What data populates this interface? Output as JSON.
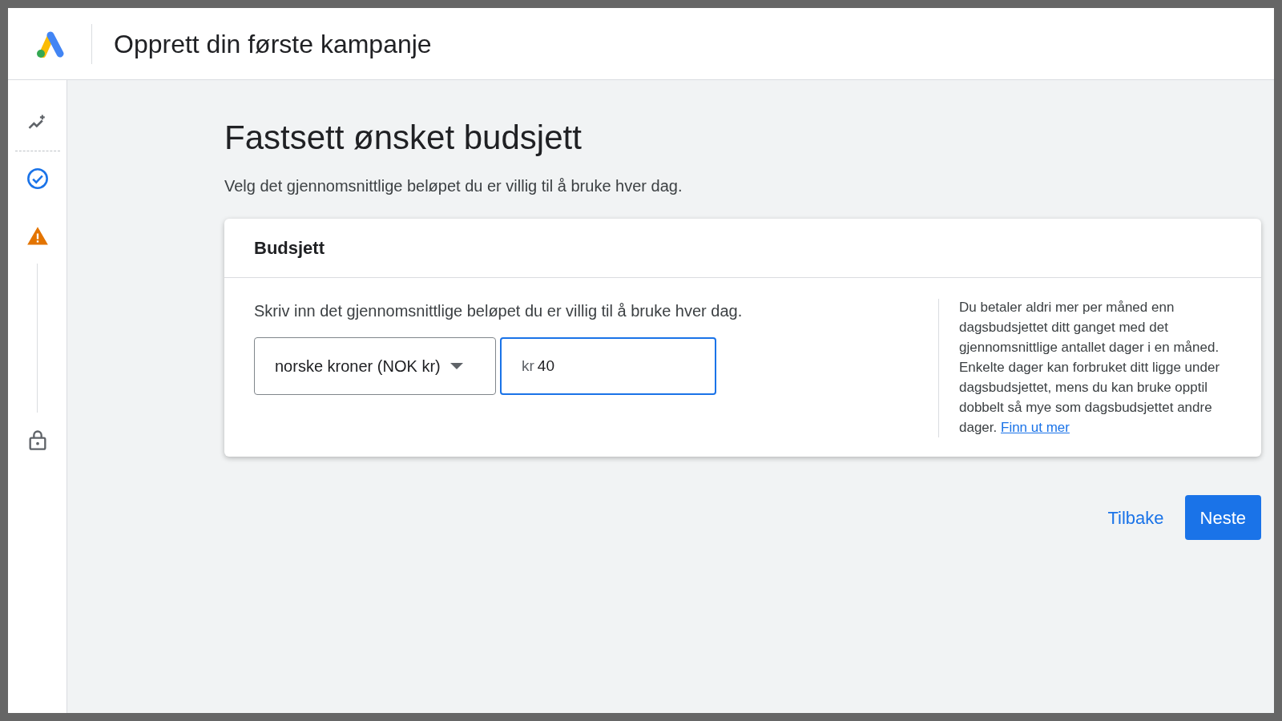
{
  "header": {
    "title": "Opprett din første kampanje"
  },
  "sidebar": {
    "steps": [
      {
        "kind": "sparkle"
      },
      {
        "kind": "done"
      },
      {
        "kind": "warning"
      },
      {
        "kind": "locked"
      }
    ]
  },
  "page": {
    "title": "Fastsett ønsket budsjett",
    "subtitle": "Velg det gjennomsnittlige beløpet du er villig til å bruke hver dag."
  },
  "card": {
    "title": "Budsjett",
    "prompt": "Skriv inn det gjennomsnittlige beløpet du er villig til å bruke hver dag.",
    "currency": {
      "value": "norske kroner (NOK kr)"
    },
    "amount": {
      "prefix": "kr",
      "value": "40",
      "focused": true
    },
    "help": {
      "text": "Du betaler aldri mer per måned enn dagsbudsjettet ditt ganget med det gjennomsnittlige antallet dager i en måned. Enkelte dager kan forbruket ditt ligge under dagsbudsjettet, mens du kan bruke opptil dobbelt så mye som dagsbudsjettet andre dager.",
      "link": "Finn ut mer"
    }
  },
  "buttons": [
    {
      "kind": "text",
      "label": "Tilbake"
    },
    {
      "kind": "primary",
      "label": "Neste"
    }
  ]
}
